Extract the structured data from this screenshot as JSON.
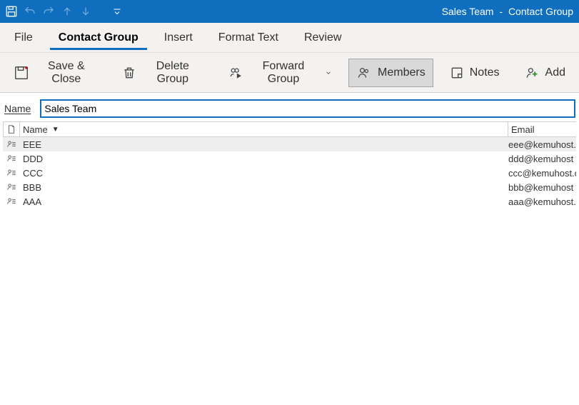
{
  "title": {
    "window_name": "Sales Team",
    "sep": "-",
    "context": "Contact Group"
  },
  "tabs": {
    "file": "File",
    "contact_group": "Contact Group",
    "insert": "Insert",
    "format_text": "Format Text",
    "review": "Review"
  },
  "ribbon": {
    "save_close": "Save & Close",
    "delete_group": "Delete Group",
    "forward_group": "Forward Group",
    "members": "Members",
    "notes": "Notes",
    "add": "Add"
  },
  "name_field": {
    "label": "Name",
    "value": "Sales Team"
  },
  "grid": {
    "headers": {
      "name": "Name",
      "email": "Email"
    },
    "rows": [
      {
        "name": "EEE",
        "email": "eee@kemuhost.",
        "selected": true
      },
      {
        "name": "DDD",
        "email": "ddd@kemuhost",
        "selected": false
      },
      {
        "name": "CCC",
        "email": "ccc@kemuhost.c",
        "selected": false
      },
      {
        "name": "BBB",
        "email": "bbb@kemuhost",
        "selected": false
      },
      {
        "name": "AAA",
        "email": "aaa@kemuhost.c",
        "selected": false
      }
    ]
  }
}
